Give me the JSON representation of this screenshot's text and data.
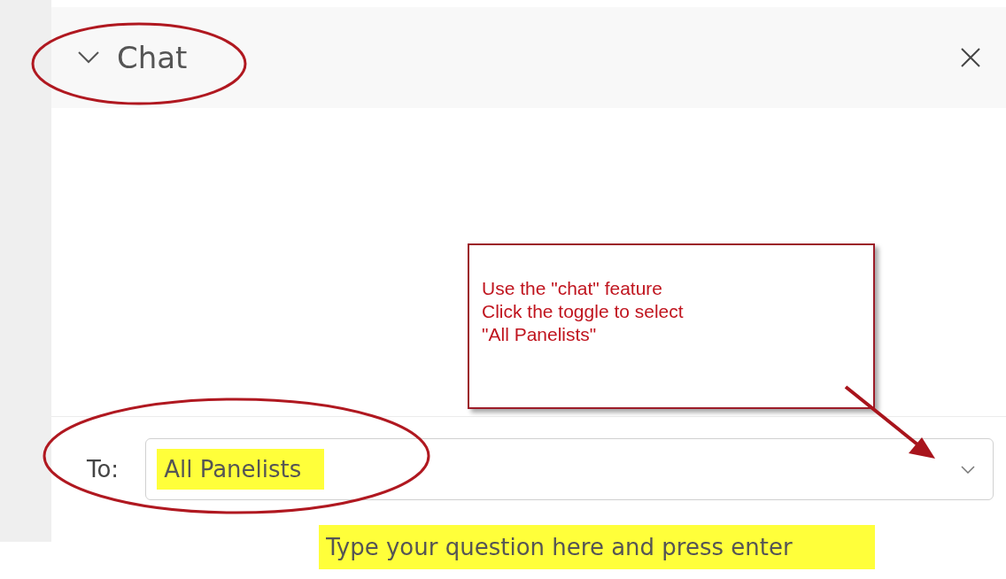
{
  "panel": {
    "title": "Chat",
    "expanded": true
  },
  "recipient": {
    "label": "To:",
    "value": "All Panelists",
    "highlighted": true
  },
  "message": {
    "placeholder": "Type your question here and press enter",
    "highlighted": true
  },
  "annotation": {
    "lines": [
      "Use the \"chat\" feature",
      "Click the toggle to select",
      "\"All Panelists\""
    ]
  }
}
